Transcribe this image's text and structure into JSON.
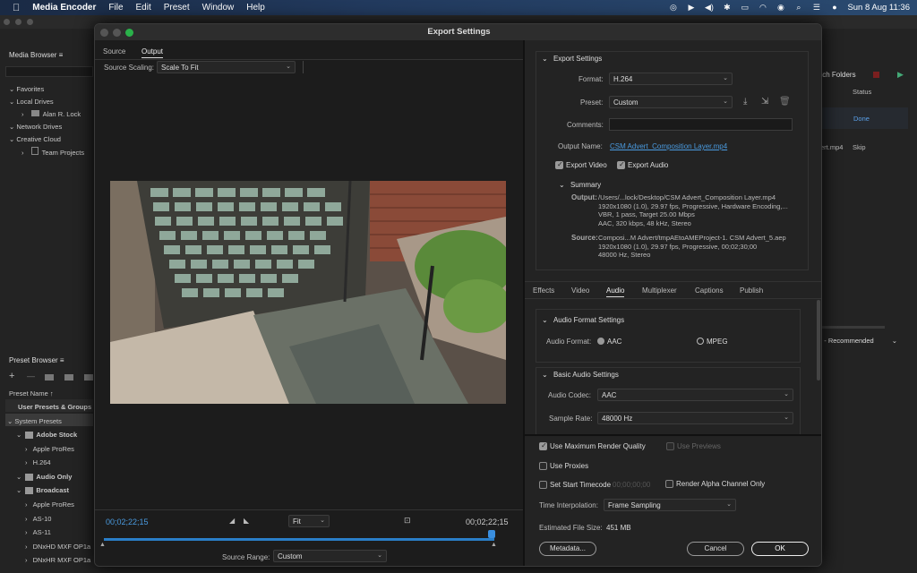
{
  "menubar": {
    "apple": "",
    "app_name": "Media Encoder",
    "menus": [
      "File",
      "Edit",
      "Preset",
      "Window",
      "Help"
    ],
    "clock": "Sun 8 Aug  11:36"
  },
  "bg": {
    "media_browser": {
      "title": "Media Browser",
      "favorites": "Favorites",
      "local_drives": "Local Drives",
      "alan": "Alan R. Lock",
      "network_drives": "Network Drives",
      "creative_cloud": "Creative Cloud",
      "team_projects": "Team Projects"
    },
    "queue": {
      "watch_folders": "tch Folders",
      "status_header": "Status",
      "done": "Done",
      "file": "ert.mp4",
      "skip": "Skip",
      "recommended": "l) - Recommended"
    },
    "preset_browser": {
      "title": "Preset Browser",
      "preset_name": "Preset Name",
      "user_presets": "User Presets & Groups",
      "system_presets": "System Presets",
      "items": [
        {
          "label": "Adobe Stock",
          "indent": 1,
          "icon": "St"
        },
        {
          "label": "Apple ProRes",
          "indent": 2
        },
        {
          "label": "H.264",
          "indent": 2
        },
        {
          "label": "Audio Only",
          "indent": 1,
          "icon": "audio"
        },
        {
          "label": "Broadcast",
          "indent": 1,
          "icon": "tv"
        },
        {
          "label": "Apple ProRes",
          "indent": 2
        },
        {
          "label": "AS-10",
          "indent": 2
        },
        {
          "label": "AS-11",
          "indent": 2
        },
        {
          "label": "DNxHD MXF OP1a",
          "indent": 2
        },
        {
          "label": "DNxHR MXF OP1a",
          "indent": 2
        }
      ]
    }
  },
  "dialog": {
    "title": "Export Settings",
    "tabs": {
      "source": "Source",
      "output": "Output"
    },
    "source_scaling_label": "Source Scaling:",
    "source_scaling_value": "Scale To Fit",
    "timecode_left": "00;02;22;15",
    "timecode_right": "00;02;22;15",
    "fit_value": "Fit",
    "source_range_label": "Source Range:",
    "source_range_value": "Custom",
    "export_settings": {
      "header": "Export Settings",
      "format_label": "Format:",
      "format_value": "H.264",
      "preset_label": "Preset:",
      "preset_value": "Custom",
      "comments_label": "Comments:",
      "output_name_label": "Output Name:",
      "output_name_value": "CSM Advert_Composition Layer.mp4",
      "export_video": "Export Video",
      "export_audio": "Export Audio",
      "summary_header": "Summary",
      "output_label": "Output:",
      "output_lines": [
        "/Users/...lock/Desktop/CSM Advert_Composition Layer.mp4",
        "1920x1080 (1.0), 29.97 fps, Progressive, Hardware Encoding,...",
        "VBR, 1 pass, Target 25.00 Mbps",
        "AAC, 320 kbps, 48 kHz, Stereo"
      ],
      "source_label": "Source:",
      "source_lines": [
        "Composi...M Advert/tmpAEtoAMEProject-1. CSM Advert_5.aep",
        "1920x1080 (1.0), 29.97 fps, Progressive, 00;02;30;00",
        "48000 Hz, Stereo"
      ]
    },
    "settings_tabs": [
      "Effects",
      "Video",
      "Audio",
      "Multiplexer",
      "Captions",
      "Publish"
    ],
    "active_settings_tab": "Audio",
    "audio": {
      "format_header": "Audio Format Settings",
      "format_label": "Audio Format:",
      "aac": "AAC",
      "mpeg": "MPEG",
      "basic_header": "Basic Audio Settings",
      "codec_label": "Audio Codec:",
      "codec_value": "AAC",
      "sample_rate_label": "Sample Rate:",
      "sample_rate_value": "48000 Hz"
    },
    "bottom": {
      "max_render": "Use Maximum Render Quality",
      "use_previews": "Use Previews",
      "use_proxies": "Use Proxies",
      "set_start_tc": "Set Start Timecode",
      "start_tc_value": "00;00;00;00",
      "render_alpha": "Render Alpha Channel Only",
      "interp_label": "Time Interpolation:",
      "interp_value": "Frame Sampling",
      "file_size_label": "Estimated File Size:",
      "file_size_value": "451 MB",
      "metadata": "Metadata...",
      "cancel": "Cancel",
      "ok": "OK"
    }
  }
}
